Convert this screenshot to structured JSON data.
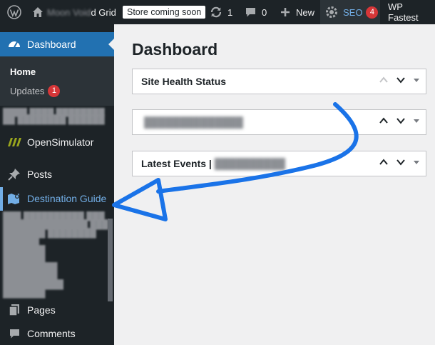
{
  "admin_bar": {
    "wp_logo_icon": "wordpress-logo-icon",
    "home_icon": "home-icon",
    "site_name_obscured": "Moon Void",
    "site_name_visible": "d Grid",
    "store_badge": "Store coming soon",
    "updates_count": "1",
    "comments_count": "0",
    "new_label": "New",
    "seo_label": "SEO",
    "seo_count": "4",
    "wp_fastest_label": "WP Fastest"
  },
  "sidebar": {
    "dashboard_label": "Dashboard",
    "submenu": {
      "home_label": "Home",
      "updates_label": "Updates",
      "updates_count": "1"
    },
    "opensimulator_label": "OpenSimulator",
    "posts_label": "Posts",
    "destination_guide_label": "Destination Guide",
    "pages_label": "Pages",
    "comments_label": "Comments"
  },
  "main": {
    "page_title": "Dashboard",
    "postboxes": [
      {
        "title": "Site Health Status"
      },
      {
        "title": ""
      },
      {
        "title": "Latest Events |"
      }
    ]
  },
  "colors": {
    "admin_bar_bg": "#1d2327",
    "sidebar_active_bg": "#2271b1",
    "highlight_link": "#72aee6",
    "annotation_arrow": "#1a73e8",
    "badge_red": "#d63638"
  }
}
